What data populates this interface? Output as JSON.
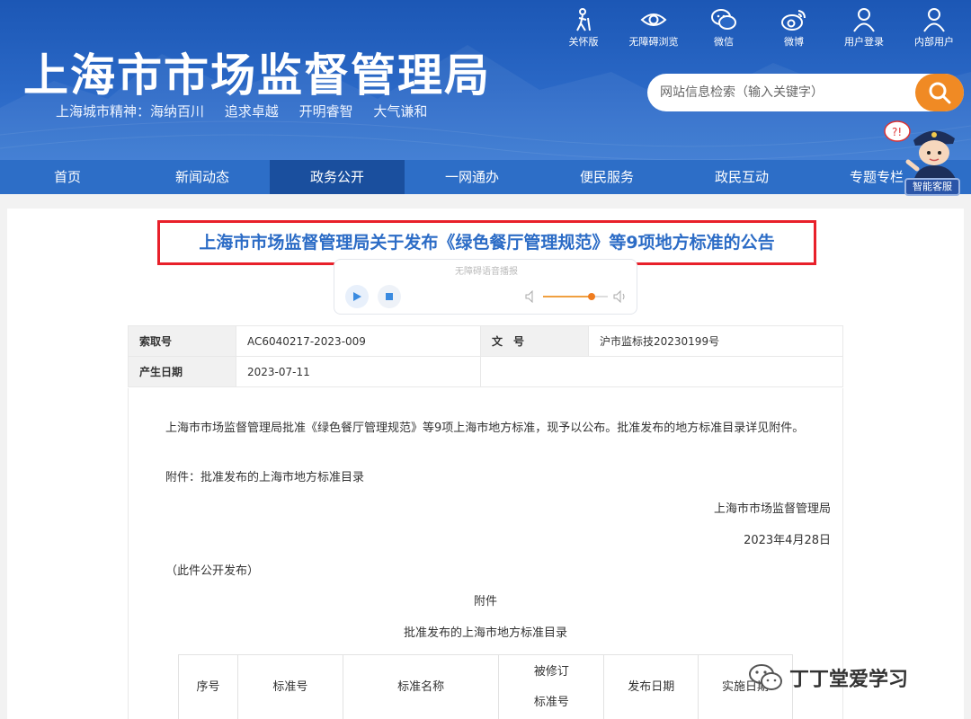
{
  "header": {
    "site_title": "上海市市场监督管理局",
    "slogan": [
      "上海城市精神：海纳百川",
      "追求卓越",
      "开明睿智",
      "大气谦和"
    ],
    "tools": [
      {
        "label": "关怀版",
        "icon": "elder-care-icon"
      },
      {
        "label": "无障碍浏览",
        "icon": "eye-icon"
      },
      {
        "label": "微信",
        "icon": "wechat-icon"
      },
      {
        "label": "微博",
        "icon": "weibo-icon"
      },
      {
        "label": "用户登录",
        "icon": "user-icon"
      },
      {
        "label": "内部用户",
        "icon": "internal-user-icon"
      }
    ],
    "search_placeholder": "网站信息检索（输入关键字）"
  },
  "nav": {
    "items": [
      "首页",
      "新闻动态",
      "政务公开",
      "一网通办",
      "便民服务",
      "政民互动",
      "专题专栏"
    ],
    "active_index": 2
  },
  "assistant": {
    "label": "智能客服"
  },
  "article": {
    "title": "上海市市场监督管理局关于发布《绿色餐厅管理规范》等9项地方标准的公告",
    "player_title": "无障碍语音播报",
    "player_volume": 0.75,
    "meta": {
      "index_no_label": "索取号",
      "index_no": "AC6040217-2023-009",
      "doc_no_label": "文　号",
      "doc_no": "沪市监标技20230199号",
      "date_label": "产生日期",
      "date": "2023-07-11"
    },
    "paragraph1": "上海市市场监督管理局批准《绿色餐厅管理规范》等9项上海市地方标准，现予以公布。批准发布的地方标准目录详见附件。",
    "paragraph2": "附件：批准发布的上海市地方标准目录",
    "signature": "上海市市场监督管理局",
    "sign_date": "2023年4月28日",
    "publish_note": "（此件公开发布）",
    "attachment_heading": "附件",
    "attachment_title": "批准发布的上海市地方标准目录",
    "table_headers": [
      "序号",
      "标准号",
      "标准名称",
      "被修订\n标准号",
      "发布日期",
      "实施日期"
    ]
  },
  "watermark": {
    "text": "丁丁堂爱学习"
  },
  "colors": {
    "header_blue": "#2a68c6",
    "nav_active": "#1a4f9e",
    "title_blue": "#2c6cc6",
    "highlight_red": "#e8202a",
    "search_orange": "#f08a24"
  }
}
